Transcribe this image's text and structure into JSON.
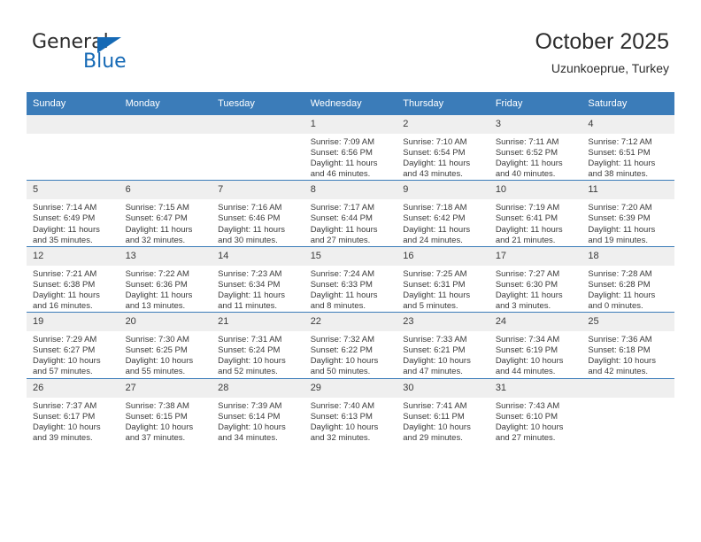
{
  "brand": {
    "name_top": "General",
    "name_bottom": "Blue",
    "triangle_icon": "triangle-icon",
    "accent_color": "#1569b5"
  },
  "header": {
    "title": "October 2025",
    "subtitle": "Uzunkoeprue, Turkey"
  },
  "calendar": {
    "header_bg": "#3b7cb9",
    "daynum_bg": "#efefef",
    "weekdays": [
      "Sunday",
      "Monday",
      "Tuesday",
      "Wednesday",
      "Thursday",
      "Friday",
      "Saturday"
    ],
    "weeks": [
      [
        {
          "day": "",
          "empty": true
        },
        {
          "day": "",
          "empty": true
        },
        {
          "day": "",
          "empty": true
        },
        {
          "day": "1",
          "sunrise": "Sunrise: 7:09 AM",
          "sunset": "Sunset: 6:56 PM",
          "daylight_line1": "Daylight: 11 hours",
          "daylight_line2": "and 46 minutes."
        },
        {
          "day": "2",
          "sunrise": "Sunrise: 7:10 AM",
          "sunset": "Sunset: 6:54 PM",
          "daylight_line1": "Daylight: 11 hours",
          "daylight_line2": "and 43 minutes."
        },
        {
          "day": "3",
          "sunrise": "Sunrise: 7:11 AM",
          "sunset": "Sunset: 6:52 PM",
          "daylight_line1": "Daylight: 11 hours",
          "daylight_line2": "and 40 minutes."
        },
        {
          "day": "4",
          "sunrise": "Sunrise: 7:12 AM",
          "sunset": "Sunset: 6:51 PM",
          "daylight_line1": "Daylight: 11 hours",
          "daylight_line2": "and 38 minutes."
        }
      ],
      [
        {
          "day": "5",
          "sunrise": "Sunrise: 7:14 AM",
          "sunset": "Sunset: 6:49 PM",
          "daylight_line1": "Daylight: 11 hours",
          "daylight_line2": "and 35 minutes."
        },
        {
          "day": "6",
          "sunrise": "Sunrise: 7:15 AM",
          "sunset": "Sunset: 6:47 PM",
          "daylight_line1": "Daylight: 11 hours",
          "daylight_line2": "and 32 minutes."
        },
        {
          "day": "7",
          "sunrise": "Sunrise: 7:16 AM",
          "sunset": "Sunset: 6:46 PM",
          "daylight_line1": "Daylight: 11 hours",
          "daylight_line2": "and 30 minutes."
        },
        {
          "day": "8",
          "sunrise": "Sunrise: 7:17 AM",
          "sunset": "Sunset: 6:44 PM",
          "daylight_line1": "Daylight: 11 hours",
          "daylight_line2": "and 27 minutes."
        },
        {
          "day": "9",
          "sunrise": "Sunrise: 7:18 AM",
          "sunset": "Sunset: 6:42 PM",
          "daylight_line1": "Daylight: 11 hours",
          "daylight_line2": "and 24 minutes."
        },
        {
          "day": "10",
          "sunrise": "Sunrise: 7:19 AM",
          "sunset": "Sunset: 6:41 PM",
          "daylight_line1": "Daylight: 11 hours",
          "daylight_line2": "and 21 minutes."
        },
        {
          "day": "11",
          "sunrise": "Sunrise: 7:20 AM",
          "sunset": "Sunset: 6:39 PM",
          "daylight_line1": "Daylight: 11 hours",
          "daylight_line2": "and 19 minutes."
        }
      ],
      [
        {
          "day": "12",
          "sunrise": "Sunrise: 7:21 AM",
          "sunset": "Sunset: 6:38 PM",
          "daylight_line1": "Daylight: 11 hours",
          "daylight_line2": "and 16 minutes."
        },
        {
          "day": "13",
          "sunrise": "Sunrise: 7:22 AM",
          "sunset": "Sunset: 6:36 PM",
          "daylight_line1": "Daylight: 11 hours",
          "daylight_line2": "and 13 minutes."
        },
        {
          "day": "14",
          "sunrise": "Sunrise: 7:23 AM",
          "sunset": "Sunset: 6:34 PM",
          "daylight_line1": "Daylight: 11 hours",
          "daylight_line2": "and 11 minutes."
        },
        {
          "day": "15",
          "sunrise": "Sunrise: 7:24 AM",
          "sunset": "Sunset: 6:33 PM",
          "daylight_line1": "Daylight: 11 hours",
          "daylight_line2": "and 8 minutes."
        },
        {
          "day": "16",
          "sunrise": "Sunrise: 7:25 AM",
          "sunset": "Sunset: 6:31 PM",
          "daylight_line1": "Daylight: 11 hours",
          "daylight_line2": "and 5 minutes."
        },
        {
          "day": "17",
          "sunrise": "Sunrise: 7:27 AM",
          "sunset": "Sunset: 6:30 PM",
          "daylight_line1": "Daylight: 11 hours",
          "daylight_line2": "and 3 minutes."
        },
        {
          "day": "18",
          "sunrise": "Sunrise: 7:28 AM",
          "sunset": "Sunset: 6:28 PM",
          "daylight_line1": "Daylight: 11 hours",
          "daylight_line2": "and 0 minutes."
        }
      ],
      [
        {
          "day": "19",
          "sunrise": "Sunrise: 7:29 AM",
          "sunset": "Sunset: 6:27 PM",
          "daylight_line1": "Daylight: 10 hours",
          "daylight_line2": "and 57 minutes."
        },
        {
          "day": "20",
          "sunrise": "Sunrise: 7:30 AM",
          "sunset": "Sunset: 6:25 PM",
          "daylight_line1": "Daylight: 10 hours",
          "daylight_line2": "and 55 minutes."
        },
        {
          "day": "21",
          "sunrise": "Sunrise: 7:31 AM",
          "sunset": "Sunset: 6:24 PM",
          "daylight_line1": "Daylight: 10 hours",
          "daylight_line2": "and 52 minutes."
        },
        {
          "day": "22",
          "sunrise": "Sunrise: 7:32 AM",
          "sunset": "Sunset: 6:22 PM",
          "daylight_line1": "Daylight: 10 hours",
          "daylight_line2": "and 50 minutes."
        },
        {
          "day": "23",
          "sunrise": "Sunrise: 7:33 AM",
          "sunset": "Sunset: 6:21 PM",
          "daylight_line1": "Daylight: 10 hours",
          "daylight_line2": "and 47 minutes."
        },
        {
          "day": "24",
          "sunrise": "Sunrise: 7:34 AM",
          "sunset": "Sunset: 6:19 PM",
          "daylight_line1": "Daylight: 10 hours",
          "daylight_line2": "and 44 minutes."
        },
        {
          "day": "25",
          "sunrise": "Sunrise: 7:36 AM",
          "sunset": "Sunset: 6:18 PM",
          "daylight_line1": "Daylight: 10 hours",
          "daylight_line2": "and 42 minutes."
        }
      ],
      [
        {
          "day": "26",
          "sunrise": "Sunrise: 7:37 AM",
          "sunset": "Sunset: 6:17 PM",
          "daylight_line1": "Daylight: 10 hours",
          "daylight_line2": "and 39 minutes."
        },
        {
          "day": "27",
          "sunrise": "Sunrise: 7:38 AM",
          "sunset": "Sunset: 6:15 PM",
          "daylight_line1": "Daylight: 10 hours",
          "daylight_line2": "and 37 minutes."
        },
        {
          "day": "28",
          "sunrise": "Sunrise: 7:39 AM",
          "sunset": "Sunset: 6:14 PM",
          "daylight_line1": "Daylight: 10 hours",
          "daylight_line2": "and 34 minutes."
        },
        {
          "day": "29",
          "sunrise": "Sunrise: 7:40 AM",
          "sunset": "Sunset: 6:13 PM",
          "daylight_line1": "Daylight: 10 hours",
          "daylight_line2": "and 32 minutes."
        },
        {
          "day": "30",
          "sunrise": "Sunrise: 7:41 AM",
          "sunset": "Sunset: 6:11 PM",
          "daylight_line1": "Daylight: 10 hours",
          "daylight_line2": "and 29 minutes."
        },
        {
          "day": "31",
          "sunrise": "Sunrise: 7:43 AM",
          "sunset": "Sunset: 6:10 PM",
          "daylight_line1": "Daylight: 10 hours",
          "daylight_line2": "and 27 minutes."
        },
        {
          "day": "",
          "empty": true
        }
      ]
    ]
  }
}
